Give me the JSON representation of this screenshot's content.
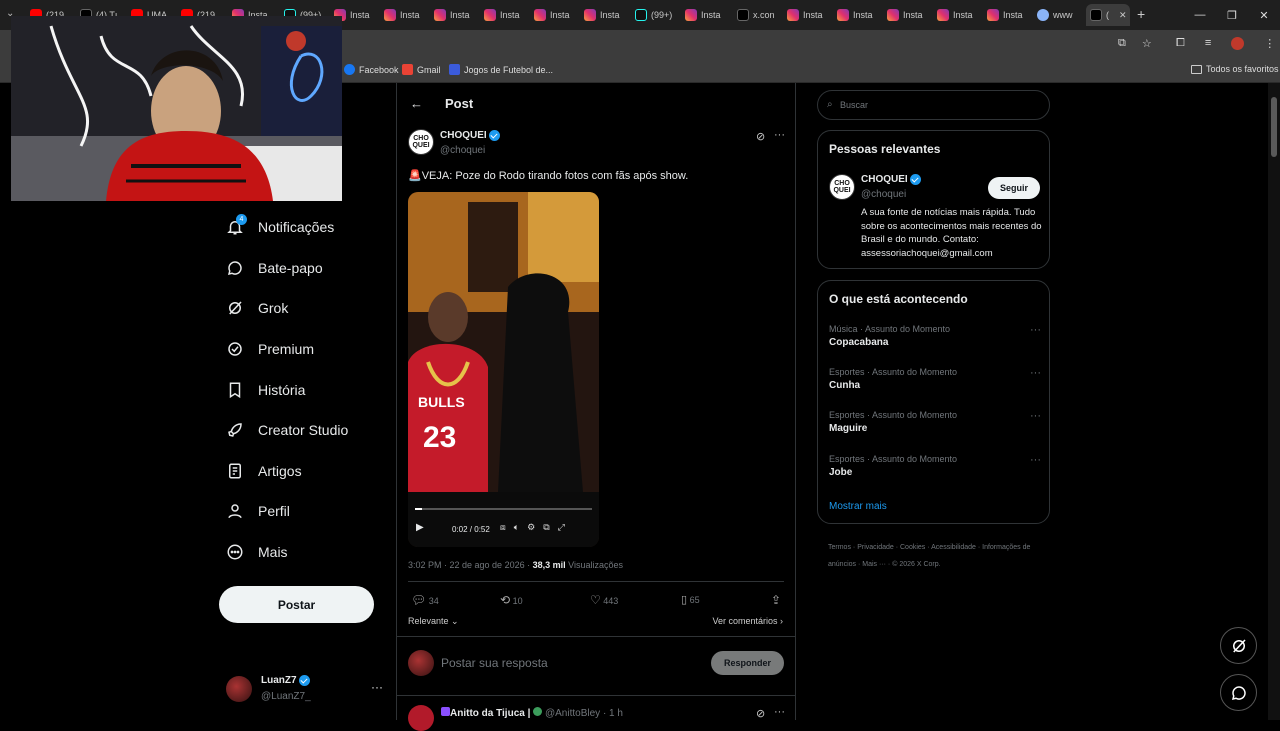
{
  "browser": {
    "tabs": [
      {
        "label": "(219",
        "icon": "yt"
      },
      {
        "label": "(4) Tı",
        "icon": "x"
      },
      {
        "label": "UMA",
        "icon": "yt"
      },
      {
        "label": "(219",
        "icon": "yt"
      },
      {
        "label": "Insta",
        "icon": "ig"
      },
      {
        "label": "(99+)",
        "icon": "tt"
      },
      {
        "label": "Insta",
        "icon": "ig"
      },
      {
        "label": "Insta",
        "icon": "ig"
      },
      {
        "label": "Insta",
        "icon": "ig"
      },
      {
        "label": "Insta",
        "icon": "ig"
      },
      {
        "label": "Insta",
        "icon": "ig"
      },
      {
        "label": "Insta",
        "icon": "ig"
      },
      {
        "label": "(99+)",
        "icon": "tt"
      },
      {
        "label": "Insta",
        "icon": "ig"
      },
      {
        "label": "x.con",
        "icon": "x"
      },
      {
        "label": "Insta",
        "icon": "ig"
      },
      {
        "label": "Insta",
        "icon": "ig"
      },
      {
        "label": "Insta",
        "icon": "ig"
      },
      {
        "label": "Insta",
        "icon": "ig"
      },
      {
        "label": "Insta",
        "icon": "ig"
      },
      {
        "label": "www",
        "icon": "gl"
      },
      {
        "label": "(",
        "icon": "x",
        "active": true
      }
    ],
    "bookmarks": [
      {
        "label": "Facebook",
        "color": "#1877f2"
      },
      {
        "label": "Gmail",
        "color": "#ea4335"
      },
      {
        "label": "Jogos de Futebol de...",
        "color": "#3b5bdb"
      }
    ],
    "all_bookmarks": "Todos os favoritos"
  },
  "nav": {
    "notif_count": "4",
    "items": [
      {
        "label": "Notificações",
        "icon": "bell-icon"
      },
      {
        "label": "Bate-papo",
        "icon": "chat-icon"
      },
      {
        "label": "Grok",
        "icon": "grok-icon"
      },
      {
        "label": "Premium",
        "icon": "premium-icon"
      },
      {
        "label": "História",
        "icon": "bookmark-icon"
      },
      {
        "label": "Creator Studio",
        "icon": "rocket-icon"
      },
      {
        "label": "Artigos",
        "icon": "article-icon"
      },
      {
        "label": "Perfil",
        "icon": "person-icon"
      },
      {
        "label": "Mais",
        "icon": "more-circle-icon"
      }
    ],
    "post_button": "Postar",
    "account": {
      "name": "LuanZ7",
      "handle": "@LuanZ7_"
    }
  },
  "post": {
    "header": "Post",
    "author": {
      "name": "CHOQUEI",
      "handle": "@choquei",
      "avatar_text": "CHO QUEI"
    },
    "text": "🚨VEJA: Poze do Rodo tirando fotos com fãs após show.",
    "video": {
      "time": "0:02 / 0:52",
      "progress": 0.04
    },
    "meta": {
      "time": "3:02 PM · 22 de ago de 2026 · ",
      "views": "38,3 mil",
      "views_label": " Visualizações"
    },
    "stats": {
      "replies": "34",
      "reposts": "10",
      "likes": "443",
      "bookmarks": "65"
    },
    "sort_label": "Relevante",
    "comments_link": "Ver comentários",
    "reply_placeholder": "Postar sua resposta",
    "reply_button": "Responder",
    "next": {
      "name": "Anitto da Tijuca |",
      "handle": "@AnittoBley",
      "time": "· 1 h"
    }
  },
  "sidebar": {
    "search_placeholder": "Buscar",
    "relevant": {
      "title": "Pessoas relevantes",
      "name": "CHOQUEI",
      "handle": "@choquei",
      "follow": "Seguir",
      "bio": "A sua fonte de notícias mais rápida. Tudo sobre os acontecimentos mais recentes do Brasil e do mundo. Contato: assessoriachoquei@gmail.com"
    },
    "trending": {
      "title": "O que está acontecendo",
      "items": [
        {
          "category": "Música · Assunto do Momento",
          "name": "Copacabana"
        },
        {
          "category": "Esportes · Assunto do Momento",
          "name": "Cunha"
        },
        {
          "category": "Esportes · Assunto do Momento",
          "name": "Maguire"
        },
        {
          "category": "Esportes · Assunto do Momento",
          "name": "Jobe"
        }
      ],
      "show_more": "Mostrar mais"
    },
    "footer": [
      "Termos",
      "Privacidade",
      "Cookies",
      "Acessibilidade",
      "Informações de anúncios",
      "Mais ···",
      "© 2026 X Corp."
    ]
  }
}
